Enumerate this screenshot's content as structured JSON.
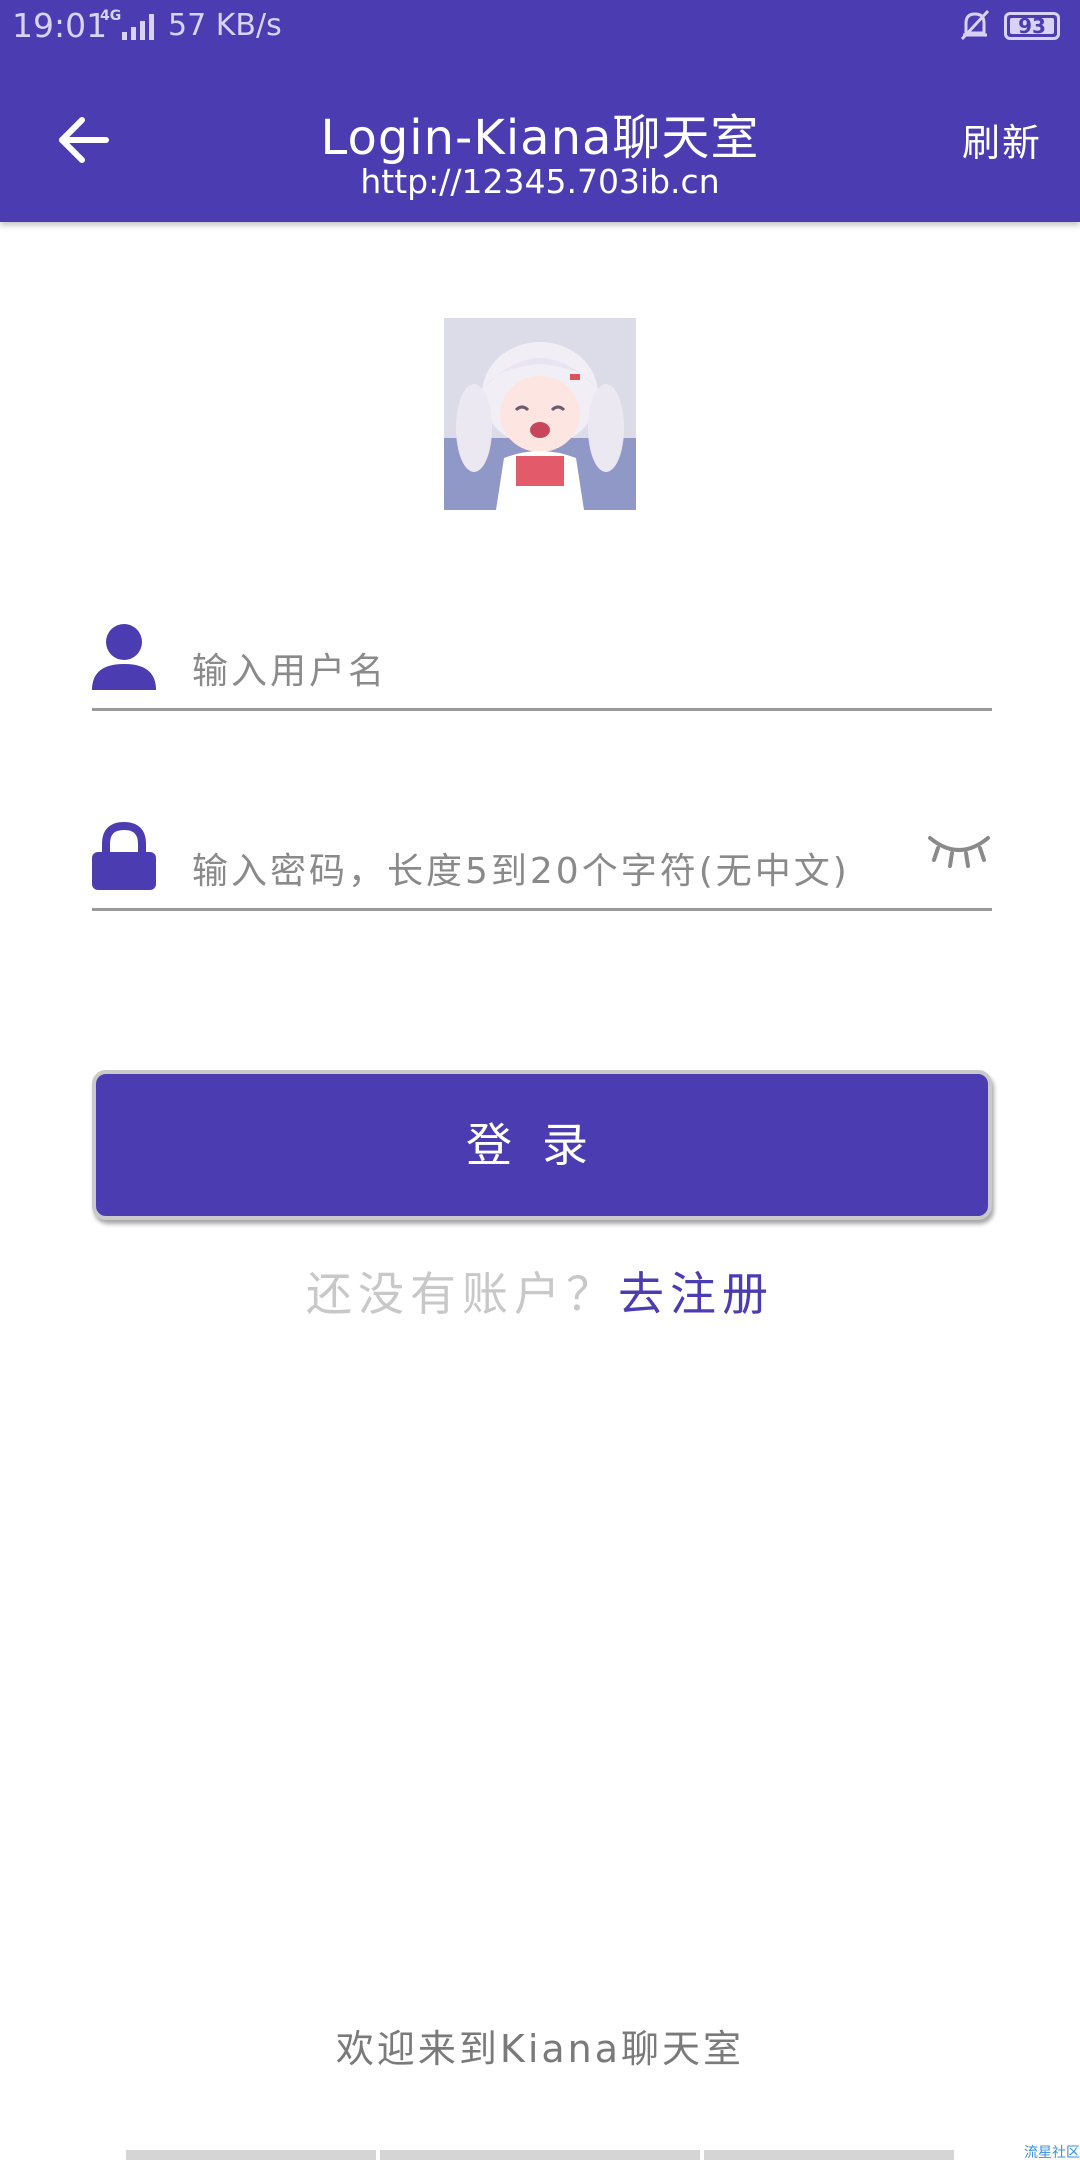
{
  "status_bar": {
    "time": "19:01",
    "network": "4G",
    "speed": "57 KB/s",
    "battery": "93"
  },
  "header": {
    "title": "Login-Kiana聊天室",
    "subtitle": "http://12345.703ib.cn",
    "refresh_label": "刷新",
    "back_icon": "arrow-left-icon"
  },
  "form": {
    "username_placeholder": "输入用户名",
    "password_placeholder": "输入密码，长度5到20个字符(无中文)",
    "login_label": "登录"
  },
  "register": {
    "hint": "还没有账户？",
    "link": "去注册"
  },
  "footer": {
    "welcome": "欢迎来到Kiana聊天室",
    "watermark": "流星社区"
  },
  "colors": {
    "accent": "#4b3cb2",
    "hint_text": "#8a8a8a",
    "muted": "#c8c8c8"
  }
}
